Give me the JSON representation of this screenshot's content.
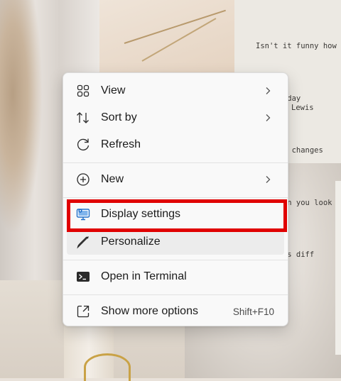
{
  "desktop": {
    "quote_lines": [
      "Isn't it funny how",
      "day by day",
      "nothing changes",
      "but when you look",
      "thing is diff"
    ],
    "quote_author": "Lewis"
  },
  "context_menu": {
    "items": [
      {
        "label": "View",
        "icon": "view-grid-icon",
        "has_submenu": true
      },
      {
        "label": "Sort by",
        "icon": "sort-icon",
        "has_submenu": true
      },
      {
        "label": "Refresh",
        "icon": "refresh-icon",
        "has_submenu": false
      },
      {
        "label": "New",
        "icon": "new-plus-icon",
        "has_submenu": true
      },
      {
        "label": "Display settings",
        "icon": "display-settings-icon",
        "has_submenu": false
      },
      {
        "label": "Personalize",
        "icon": "personalize-brush-icon",
        "has_submenu": false
      },
      {
        "label": "Open in Terminal",
        "icon": "terminal-icon",
        "has_submenu": false
      },
      {
        "label": "Show more options",
        "icon": "show-more-options-icon",
        "shortcut": "Shift+F10"
      }
    ],
    "highlighted_item": "Display settings",
    "hovered_item": "Personalize"
  },
  "colors": {
    "highlight_border": "#e00000",
    "menu_background": "#f9f9f9",
    "icon_accent": "#1f6fc9"
  }
}
